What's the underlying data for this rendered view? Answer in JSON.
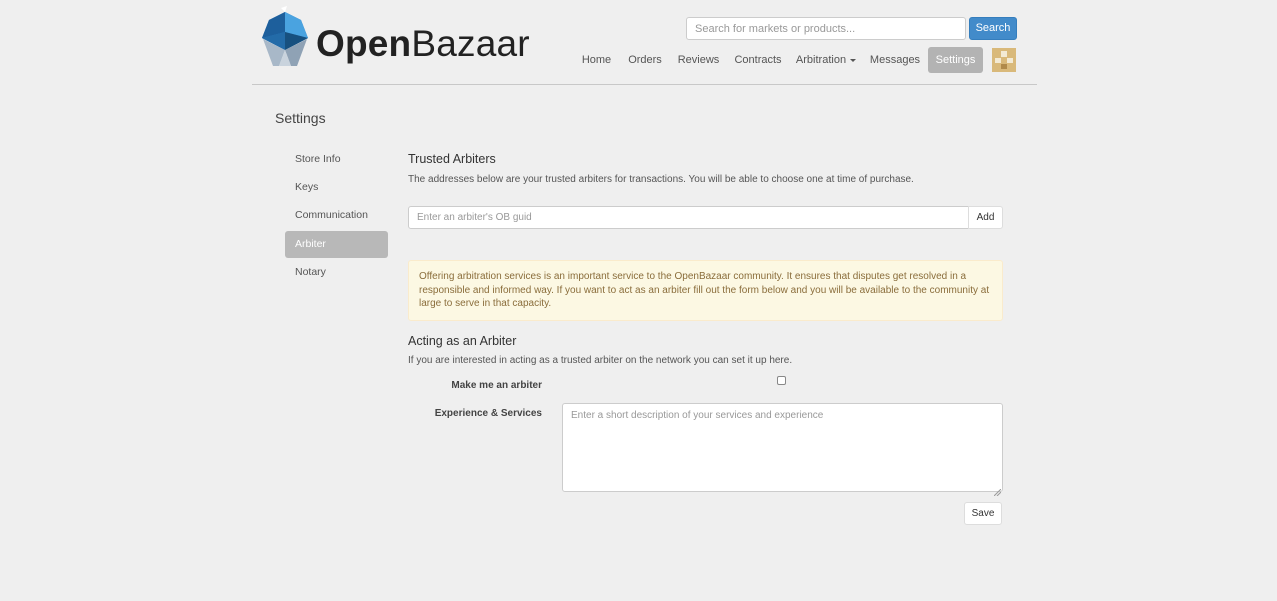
{
  "brand": {
    "name_bold": "Open",
    "name_light": "Bazaar"
  },
  "search": {
    "placeholder": "Search for markets or products...",
    "button_label": "Search"
  },
  "nav": {
    "items": [
      {
        "label": "Home"
      },
      {
        "label": "Orders"
      },
      {
        "label": "Reviews"
      },
      {
        "label": "Contracts"
      },
      {
        "label": "Arbitration"
      },
      {
        "label": "Messages"
      },
      {
        "label": "Settings",
        "active": true
      }
    ]
  },
  "page": {
    "title": "Settings"
  },
  "sidebar": {
    "items": [
      {
        "label": "Store Info"
      },
      {
        "label": "Keys"
      },
      {
        "label": "Communication"
      },
      {
        "label": "Arbiter",
        "active": true
      },
      {
        "label": "Notary"
      }
    ]
  },
  "trusted": {
    "heading": "Trusted Arbiters",
    "description": "The addresses below are your trusted arbiters for transactions. You will be able to choose one at time of purchase.",
    "input_placeholder": "Enter an arbiter's OB guid",
    "add_label": "Add"
  },
  "notice": {
    "text": "Offering arbitration services is an important service to the OpenBazaar community. It ensures that disputes get resolved in a responsible and informed way. If you want to act as an arbiter fill out the form below and you will be available to the community at large to serve in that capacity."
  },
  "acting": {
    "heading": "Acting as an Arbiter",
    "description": "If you are interested in acting as a trusted arbiter on the network you can set it up here.",
    "make_arbiter_label": "Make me an arbiter",
    "make_arbiter_checked": false,
    "experience_label": "Experience & Services",
    "experience_placeholder": "Enter a short description of your services and experience",
    "save_label": "Save"
  },
  "colors": {
    "background": "#efefef",
    "primary": "#428bca",
    "active_nav": "#b3b3b3",
    "notice_bg": "#fcf8e3",
    "notice_text": "#8a6d3b",
    "logo_blue": "#2a7bc4"
  }
}
